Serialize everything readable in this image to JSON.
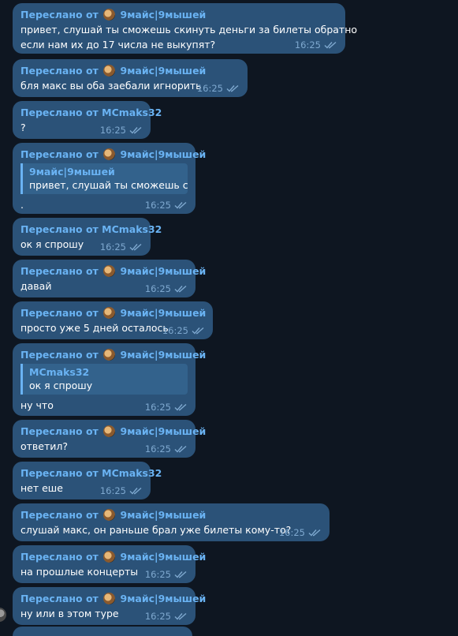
{
  "forward_prefix": "Переслано от",
  "messages": [
    {
      "from": "9майс|9мышей",
      "avatar": true,
      "lines": [
        "привет, слушай ты сможешь скинуть деньги за билеты обратно",
        "если нам их до 17 числа не выкупят?"
      ],
      "time": "16:25"
    },
    {
      "from": "9майс|9мышей",
      "avatar": true,
      "lines": [
        "бля макс вы оба заебали игнорить"
      ],
      "time": "16:25"
    },
    {
      "from": "MCmaks32",
      "avatar": false,
      "lines": [
        "?"
      ],
      "time": "16:25"
    },
    {
      "from": "9майс|9мышей",
      "avatar": true,
      "quote": {
        "name": "9майс|9мышей",
        "text": "привет, слушай ты сможешь с..."
      },
      "lines": [
        "."
      ],
      "time": "16:25"
    },
    {
      "from": "MCmaks32",
      "avatar": false,
      "lines": [
        "ок я спрошу"
      ],
      "time": "16:25"
    },
    {
      "from": "9майс|9мышей",
      "avatar": true,
      "lines": [
        "давай"
      ],
      "time": "16:25"
    },
    {
      "from": "9майс|9мышей",
      "avatar": true,
      "lines": [
        "просто уже 5 дней осталось"
      ],
      "time": "16:25"
    },
    {
      "from": "9майс|9мышей",
      "avatar": true,
      "quote": {
        "name": "MCmaks32",
        "text": "ок я спрошу"
      },
      "lines": [
        "ну что"
      ],
      "time": "16:25"
    },
    {
      "from": "9майс|9мышей",
      "avatar": true,
      "lines": [
        "ответил?"
      ],
      "time": "16:25"
    },
    {
      "from": "MCmaks32",
      "avatar": false,
      "lines": [
        "нет еше"
      ],
      "time": "16:25"
    },
    {
      "from": "9майс|9мышей",
      "avatar": true,
      "lines": [
        "слушай макс, он раньше брал уже билеты кому-то?"
      ],
      "time": "16:25"
    },
    {
      "from": "9майс|9мышей",
      "avatar": true,
      "lines": [
        "на прошлые концерты"
      ],
      "time": "16:25"
    },
    {
      "from": "9майс|9мышей",
      "avatar": true,
      "lines": [
        "ну или в этом туре"
      ],
      "time": "16:25"
    }
  ],
  "icons": {
    "read_status": "double-check-icon",
    "forward_avatar": "user-avatar"
  },
  "colors": {
    "background": "#0e1621",
    "bubble": "#2b5278",
    "accent": "#6ab3f3",
    "meta": "#7ea8cf"
  }
}
